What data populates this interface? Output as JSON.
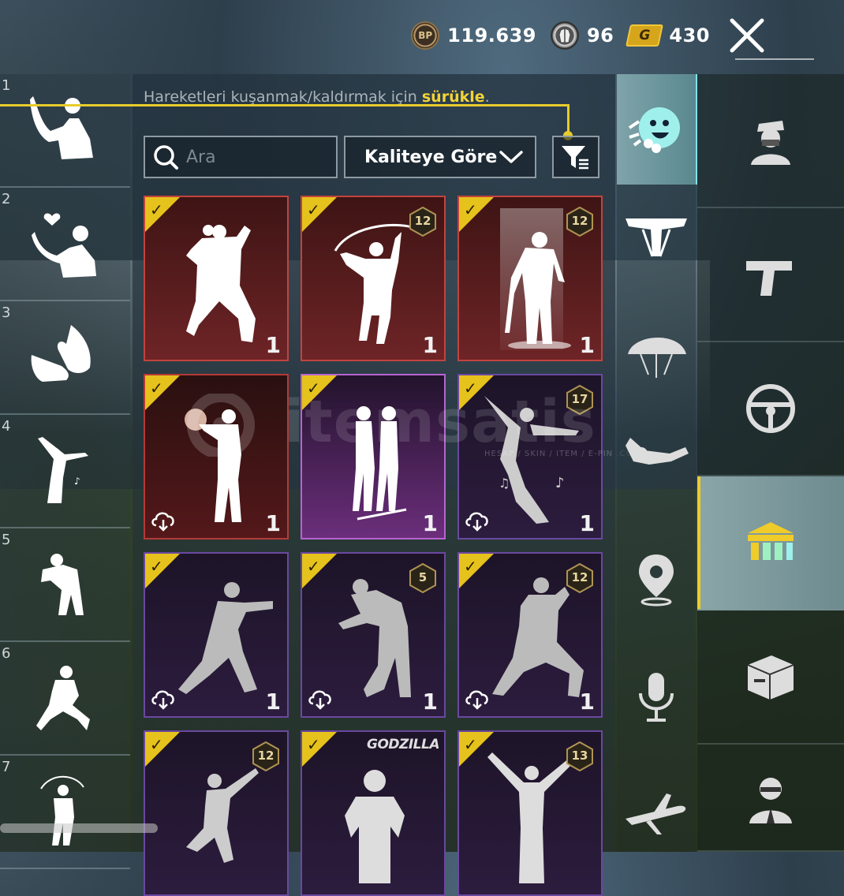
{
  "currency": {
    "bp": {
      "icon_label": "BP",
      "value": "119.639"
    },
    "ag": {
      "value": "96"
    },
    "gold": {
      "icon_label": "G",
      "value": "430"
    }
  },
  "close_icon": "close-icon",
  "hint": {
    "text": "Hareketleri kuşanmak/kaldırmak için ",
    "highlight": "sürükle",
    "end": "."
  },
  "search": {
    "placeholder": "Ara"
  },
  "sort": {
    "label": "Kaliteye Göre"
  },
  "slots": [
    {
      "num": "1"
    },
    {
      "num": "2"
    },
    {
      "num": "3"
    },
    {
      "num": "4"
    },
    {
      "num": "5"
    },
    {
      "num": "6"
    },
    {
      "num": "7"
    }
  ],
  "cards": [
    {
      "quality": "q-red",
      "level": "",
      "count": "1",
      "cloud": false,
      "label": ""
    },
    {
      "quality": "q-red",
      "level": "12",
      "count": "1",
      "cloud": false,
      "label": ""
    },
    {
      "quality": "q-red",
      "level": "12",
      "count": "1",
      "cloud": false,
      "label": ""
    },
    {
      "quality": "q-red2",
      "level": "",
      "count": "1",
      "cloud": true,
      "label": ""
    },
    {
      "quality": "q-pink",
      "level": "",
      "count": "1",
      "cloud": false,
      "label": ""
    },
    {
      "quality": "q-purple",
      "level": "17",
      "count": "1",
      "cloud": true,
      "label": ""
    },
    {
      "quality": "q-purple",
      "level": "",
      "count": "1",
      "cloud": true,
      "label": ""
    },
    {
      "quality": "q-purple",
      "level": "5",
      "count": "1",
      "cloud": true,
      "label": ""
    },
    {
      "quality": "q-purple",
      "level": "12",
      "count": "1",
      "cloud": true,
      "label": ""
    },
    {
      "quality": "q-purple",
      "level": "12",
      "count": "",
      "cloud": false,
      "label": ""
    },
    {
      "quality": "q-purple",
      "level": "",
      "count": "",
      "cloud": false,
      "label": "GODZILLA"
    },
    {
      "quality": "q-purple",
      "level": "13",
      "count": "",
      "cloud": false,
      "label": ""
    }
  ],
  "categories": [
    "emote-icon",
    "parachute-harness-icon",
    "parachute-icon",
    "skydive-icon",
    "map-marker-icon",
    "microphone-icon",
    "airplane-icon"
  ],
  "subcategories": [
    "character-icon",
    "pistol-icon",
    "steering-wheel-icon",
    "emote-pack-icon",
    "crate-icon",
    "agent-icon"
  ],
  "watermark": {
    "brand": "itemsatis",
    "tagline": "HESAP / SKIN / ITEM / E-PIN .COM"
  },
  "colors": {
    "accent": "#e8cc2c",
    "red_quality": "#c2433e",
    "pink_quality": "#b764d0",
    "purple_quality": "#6a48a0",
    "active_cyan": "#7fe3e8"
  }
}
